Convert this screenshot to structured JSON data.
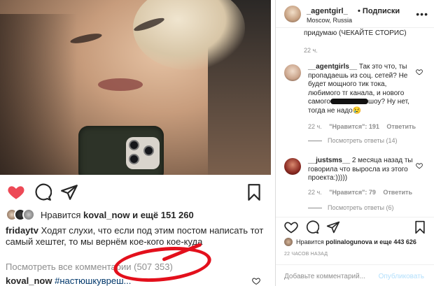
{
  "post": {
    "likes_prefix": "Нравится",
    "likes_user": "koval_now",
    "likes_suffix": "и ещё 151 260",
    "caption_user": "fridaytv",
    "caption_text": "Ходят слухи, что если под этим постом написать тот самый хештег, то мы вернём кое-кого кое-куда",
    "view_comments_label": "Посмотреть все комментарии (507 353)",
    "bottom_comment_user": "koval_now",
    "bottom_comment_tag": "#настюшкувреш..."
  },
  "sidebar": {
    "username": "_agentgirl_",
    "subscribe_label": "• Подписки",
    "location": "Moscow, Russia",
    "more_label": "•••",
    "cut_text": "придумаю (ЧЕКАЙТЕ СТОРИС)",
    "cut_time": "22 ч.",
    "comments": [
      {
        "user": "__agentgirls__",
        "text_before": "Так это что, ты пропадаешь из соц. сетей? Не будет мощного тик тока, любимого тг канала, и нового самого",
        "text_after": "шоу? Ну нет, тогда не надо😢",
        "time": "22 ч.",
        "likes": "\"Нравится\": 191",
        "reply_label": "Ответить",
        "replies_label": "Посмотреть ответы (14)",
        "avatar_color": "#c9a38a"
      },
      {
        "user": "__justsms__",
        "text_before": "2 месяца назад ты говорила что выросла из этого проекта:)))))",
        "text_after": "",
        "time": "22 ч.",
        "likes": "\"Нравится\": 79",
        "reply_label": "Ответить",
        "replies_label": "Посмотреть ответы (6)",
        "avatar_color": "#8a2a22"
      }
    ],
    "likes_prefix": "Нравится",
    "likes_user": "polinalogunova",
    "likes_suffix": "и еще 443 626",
    "time_ago": "22 ЧАСОВ НАЗАД",
    "comment_placeholder": "Добавьте комментарий...",
    "publish_label": "Опубликовать"
  },
  "colors": {
    "like_red": "#ed4956",
    "annotation_red": "#e3101c",
    "link_blue": "#00376b",
    "muted": "#8e8e8e",
    "publish_disabled": "#b2dffc"
  },
  "icons": [
    "heart-icon",
    "comment-icon",
    "share-icon",
    "bookmark-icon",
    "more-icon"
  ]
}
